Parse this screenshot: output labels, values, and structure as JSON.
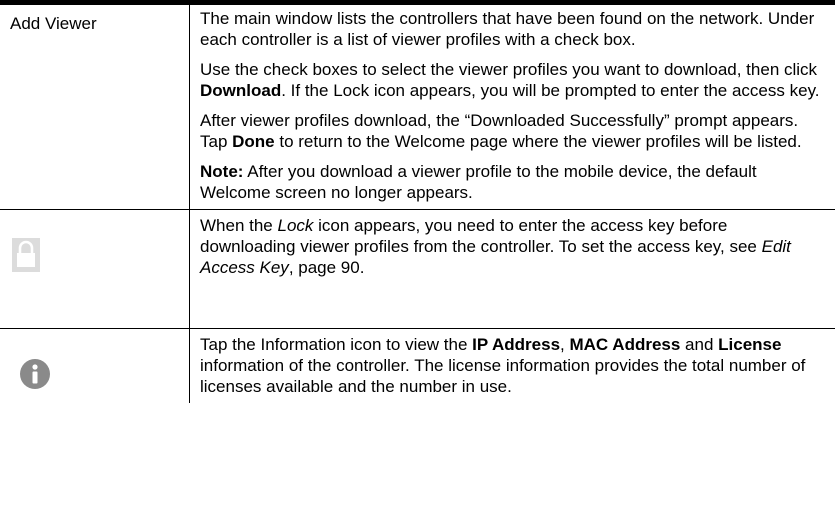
{
  "rows": [
    {
      "label": "Add Viewer",
      "paragraphs": [
        [
          "The main window lists the controllers that have been found on the network. Under each controller is a list of viewer profiles with a check box."
        ],
        [
          "Use the check boxes to select the viewer profiles you want to download, then click ",
          "Download",
          ". If the Lock icon appears, you will be prompted to enter the access key."
        ],
        [
          "After viewer profiles download, the “Downloaded Successfully” prompt appears. Tap ",
          "Done",
          " to return to the Welcome page where the viewer profiles will be listed."
        ],
        [
          "Note:",
          " After you download a viewer profile to the mobile device, the default Welcome screen no longer appears."
        ]
      ]
    },
    {
      "icon": "lock-icon",
      "paragraphs": [
        [
          "When the ",
          "Lock",
          " icon appears, you need to enter the access key before downloading viewer profiles from the controller. To set the access key, see ",
          "Edit Access Key",
          ", page 90."
        ]
      ]
    },
    {
      "icon": "info-icon",
      "paragraphs": [
        [
          "Tap the Information icon to view the ",
          "IP Address",
          ", ",
          "MAC Address",
          " and ",
          "License",
          " information of the controller. The license information provides the total number of licenses available and the number in use."
        ]
      ]
    }
  ]
}
